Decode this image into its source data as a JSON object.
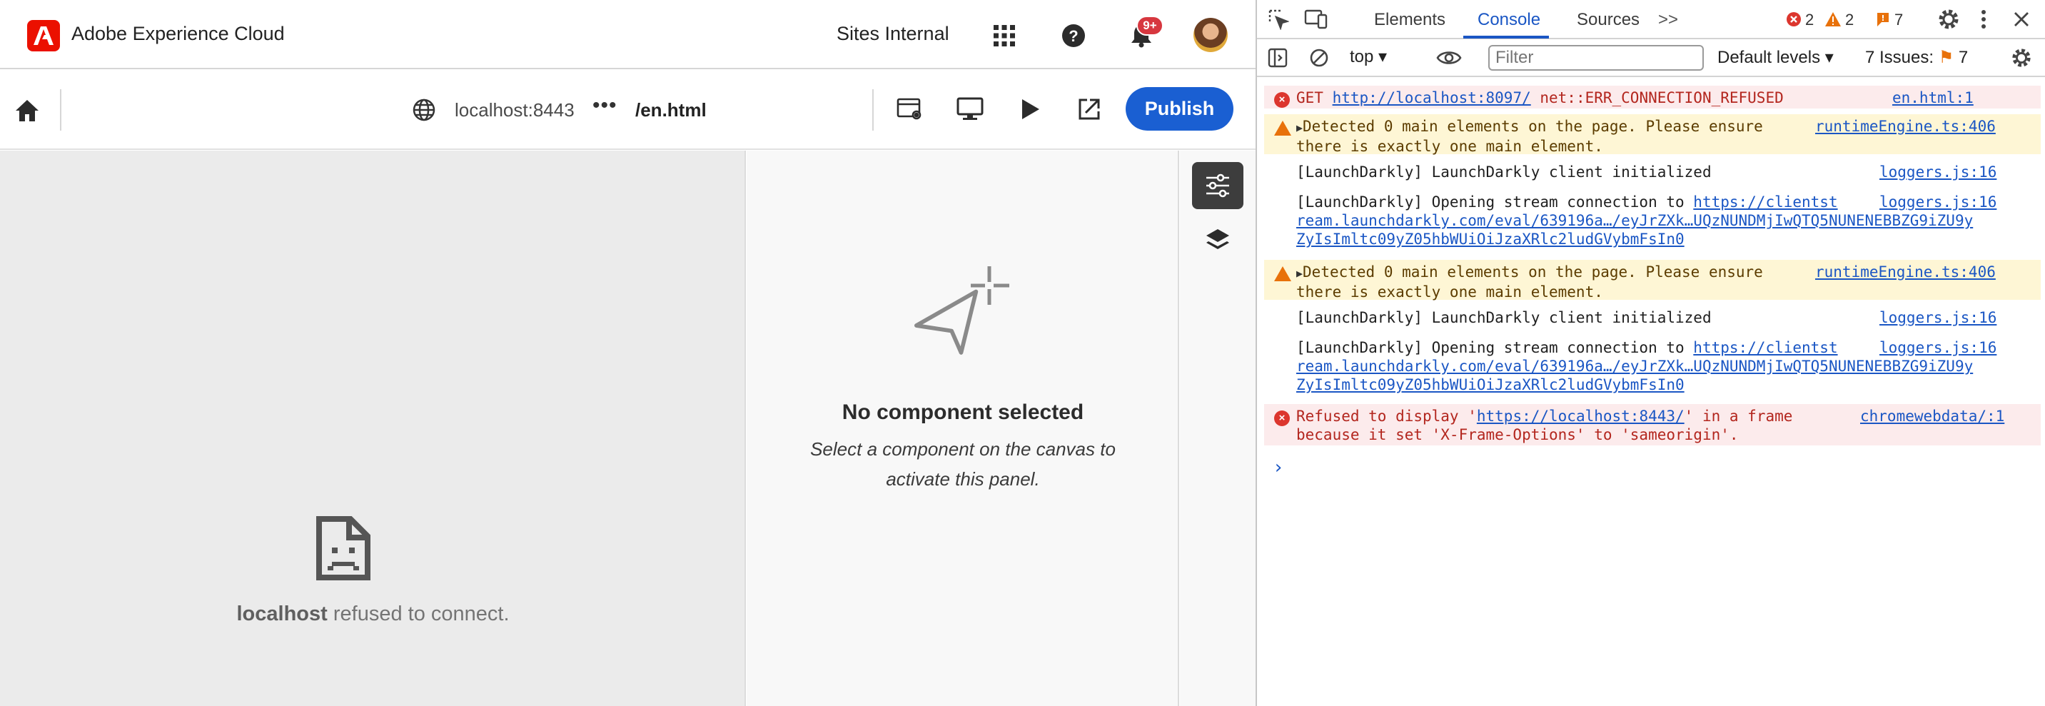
{
  "shell": {
    "title": "Adobe Experience Cloud",
    "org": "Sites Internal",
    "notifications_badge": "9+"
  },
  "toolbar": {
    "host": "localhost:8443",
    "path": "/en.html",
    "more": "•••",
    "publish_label": "Publish"
  },
  "canvas": {
    "host_bold": "localhost",
    "refused_message": " refused to connect."
  },
  "panel": {
    "title": "No component selected",
    "description": "Select a component on the canvas to activate this panel."
  },
  "devtools": {
    "tabs": [
      "Elements",
      "Console",
      "Sources"
    ],
    "active_tab": "Console",
    "more_tabs": ">>",
    "counts": {
      "errors": "2",
      "warnings": "2",
      "issues": "7"
    },
    "context": "top",
    "filter_placeholder": "Filter",
    "levels_label": "Default levels",
    "issues_label": "7 Issues:",
    "issues_count": "7"
  },
  "console": {
    "messages": [
      {
        "level": "error",
        "pre": "GET ",
        "link": "http://localhost:8097/",
        "post": " net::ERR_CONNECTION_REFUSED",
        "source": "en.html:1"
      },
      {
        "level": "warning",
        "line1": "Detected 0 main elements on the page. Please ensure",
        "line2": "there is exactly one main element.",
        "source": "runtimeEngine.ts:406"
      },
      {
        "level": "info",
        "line1": "[LaunchDarkly] LaunchDarkly client initialized",
        "source": "loggers.js:16"
      },
      {
        "level": "info",
        "pre": "[LaunchDarkly] Opening stream connection to ",
        "link1": "https://clientst",
        "link2": "ream.launchdarkly.com/eval/639196a…/eyJrZXk…UQzNUNDMjIwQTQ5NUNENEBBZG9iZU9y",
        "link3": "ZyIsImltc09yZ05hbWUiOiJzaXRlc2ludGVybmFsIn0",
        "source": "loggers.js:16"
      },
      {
        "level": "warning",
        "line1": "Detected 0 main elements on the page. Please ensure",
        "line2": "there is exactly one main element.",
        "source": "runtimeEngine.ts:406"
      },
      {
        "level": "info",
        "line1": "[LaunchDarkly] LaunchDarkly client initialized",
        "source": "loggers.js:16"
      },
      {
        "level": "info",
        "pre": "[LaunchDarkly] Opening stream connection to ",
        "link1": "https://clientst",
        "link2": "ream.launchdarkly.com/eval/639196a…/eyJrZXk…UQzNUNDMjIwQTQ5NUNENEBBZG9iZU9y",
        "link3": "ZyIsImltc09yZ05hbWUiOiJzaXRlc2ludGVybmFsIn0",
        "source": "loggers.js:16"
      },
      {
        "level": "error",
        "pre": "Refused to display '",
        "link": "https://localhost:8443/",
        "post": "' in a frame",
        "line2": "because it set 'X-Frame-Options' to 'sameorigin'.",
        "source": "chromewebdata/:1"
      }
    ],
    "prompt": "›"
  },
  "colors": {
    "adobe_red": "#eb1000",
    "publish_blue": "#1a5fd2",
    "devtools_accent": "#1a56c4",
    "error_bg": "#fcebec",
    "warning_bg": "#fef6d5"
  }
}
